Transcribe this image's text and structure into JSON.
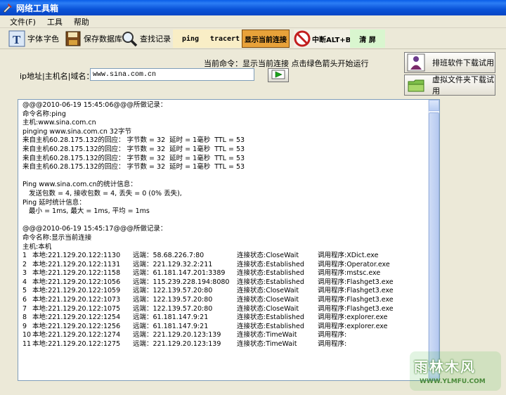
{
  "window": {
    "title": "网络工具箱"
  },
  "menu": [
    "文件(F)",
    "工具",
    "帮助"
  ],
  "toolbar": {
    "font": "字体",
    "color": "字色",
    "save_db": "保存数据库",
    "find": "查找记录",
    "ping": "ping",
    "tracert": "tracert",
    "show_conn": "显示当前连接",
    "interrupt": "中断ALT+B",
    "clear": "清 屏"
  },
  "command_hint": "当前命令：显示当前连接 点击绿色箭头开始运行",
  "ip": {
    "label": "ip地址|主机名|域名：",
    "value": "www.sina.com.cn"
  },
  "side_buttons": [
    "排班软件下载试用",
    "虚拟文件夹下载试用"
  ],
  "output": {
    "ping_block": [
      "@@@2010-06-19 15:45:06@@@所做记录：",
      "命令名称:ping",
      "主机:www.sina.com.cn",
      "pinging www.sina.com.cn 32字节",
      "来自主机60.28.175.132的回应： 字节数 = 32  延时 = 1毫秒  TTL = 53",
      "来自主机60.28.175.132的回应： 字节数 = 32  延时 = 1毫秒  TTL = 53",
      "来自主机60.28.175.132的回应： 字节数 = 32  延时 = 1毫秒  TTL = 53",
      "来自主机60.28.175.132的回应： 字节数 = 32  延时 = 1毫秒  TTL = 53",
      "",
      "Ping www.sina.com.cn的统计信息：",
      "   发送包数 = 4, 接收包数 = 4, 丢失 = 0 (0% 丢失),",
      "Ping 延时统计信息：",
      "   最小 = 1ms, 最大 = 1ms, 平均 = 1ms",
      "",
      "@@@2010-06-19 15:45:17@@@所做记录：",
      "命令名称:显示当前连接",
      "主机:本机"
    ],
    "connections": [
      [
        "1",
        "本地:221.129.20.122:1130",
        "远端：58.68.226.7:80",
        "连接状态:CloseWait",
        "调用程序:XDict.exe"
      ],
      [
        "2",
        "本地:221.129.20.122:1131",
        "远端：221.129.32.2:211",
        "连接状态:Established",
        "调用程序:Operator.exe"
      ],
      [
        "3",
        "本地:221.129.20.122:1158",
        "远端：61.181.147.201:3389",
        "连接状态:Established",
        "调用程序:mstsc.exe"
      ],
      [
        "4",
        "本地:221.129.20.122:1056",
        "远端：115.239.228.194:8080",
        "连接状态:Established",
        "调用程序:Flashget3.exe"
      ],
      [
        "5",
        "本地:221.129.20.122:1059",
        "远端：122.139.57.20:80",
        "连接状态:CloseWait",
        "调用程序:Flashget3.exe"
      ],
      [
        "6",
        "本地:221.129.20.122:1073",
        "远端：122.139.57.20:80",
        "连接状态:CloseWait",
        "调用程序:Flashget3.exe"
      ],
      [
        "7",
        "本地:221.129.20.122:1075",
        "远端：122.139.57.20:80",
        "连接状态:CloseWait",
        "调用程序:Flashget3.exe"
      ],
      [
        "8",
        "本地:221.129.20.122:1254",
        "远端：61.181.147.9:21",
        "连接状态:Established",
        "调用程序:explorer.exe"
      ],
      [
        "9",
        "本地:221.129.20.122:1256",
        "远端：61.181.147.9:21",
        "连接状态:Established",
        "调用程序:explorer.exe"
      ],
      [
        "10",
        "本地:221.129.20.122:1274",
        "远端：221.129.20.123:139",
        "连接状态:TimeWait",
        "调用程序:"
      ],
      [
        "11",
        "本地:221.129.20.122:1275",
        "远端：221.129.20.123:139",
        "连接状态:TimeWait",
        "调用程序:"
      ]
    ]
  },
  "watermark": {
    "title": "雨林木风",
    "url": "WWW.YLMFU.COM"
  },
  "colors": {
    "titlebar": "#0a53d8",
    "tab_ping": "#f9eec6",
    "tab_show": "#e8a23a",
    "tab_clear": "#d9f6cf"
  }
}
